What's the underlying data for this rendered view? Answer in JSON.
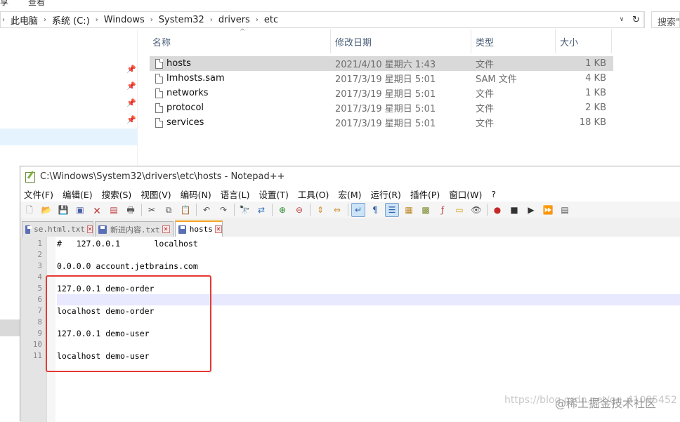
{
  "explorer": {
    "ribbon_fragments": [
      "享",
      "查看"
    ],
    "breadcrumb": [
      "此电脑",
      "系统 (C:)",
      "Windows",
      "System32",
      "drivers",
      "etc"
    ],
    "search_placeholder": "搜索\"e",
    "columns": [
      "名称",
      "修改日期",
      "类型",
      "大小"
    ],
    "files": [
      {
        "name": "hosts",
        "date": "2021/4/10 星期六 1:43",
        "type": "文件",
        "size": "1 KB",
        "selected": true
      },
      {
        "name": "lmhosts.sam",
        "date": "2017/3/19 星期日 5:01",
        "type": "SAM 文件",
        "size": "4 KB"
      },
      {
        "name": "networks",
        "date": "2017/3/19 星期日 5:01",
        "type": "文件",
        "size": "1 KB"
      },
      {
        "name": "protocol",
        "date": "2017/3/19 星期日 5:01",
        "type": "文件",
        "size": "2 KB"
      },
      {
        "name": "services",
        "date": "2017/3/19 星期日 5:01",
        "type": "文件",
        "size": "18 KB"
      }
    ]
  },
  "notepad": {
    "title": "C:\\Windows\\System32\\drivers\\etc\\hosts - Notepad++",
    "menu": [
      "文件(F)",
      "编辑(E)",
      "搜索(S)",
      "视图(V)",
      "编码(N)",
      "语言(L)",
      "设置(T)",
      "工具(O)",
      "宏(M)",
      "运行(R)",
      "插件(P)",
      "窗口(W)",
      "?"
    ],
    "tabs": [
      {
        "label": "se.html.txt",
        "active": false
      },
      {
        "label": "新进内容.txt",
        "active": false
      },
      {
        "label": "hosts",
        "active": true
      }
    ],
    "lines": [
      "#   127.0.0.1       localhost",
      "",
      "0.0.0.0 account.jetbrains.com",
      "",
      "127.0.0.1 demo-order",
      "",
      "localhost demo-order",
      "",
      "127.0.0.1 demo-user",
      "",
      "localhost demo-user"
    ],
    "line_numbers": [
      "1",
      "2",
      "3",
      "4",
      "5",
      "6",
      "7",
      "8",
      "9",
      "10",
      "11"
    ]
  },
  "watermark": {
    "url": "https://blog.csdn.net/qq_41085452",
    "brand": "@稀土掘金技术社区"
  },
  "colors": {
    "highlight_box": "#e53935",
    "selected_row": "#d9d9d9",
    "current_line": "#e8e8ff",
    "active_tab_accent": "#f5a623"
  }
}
